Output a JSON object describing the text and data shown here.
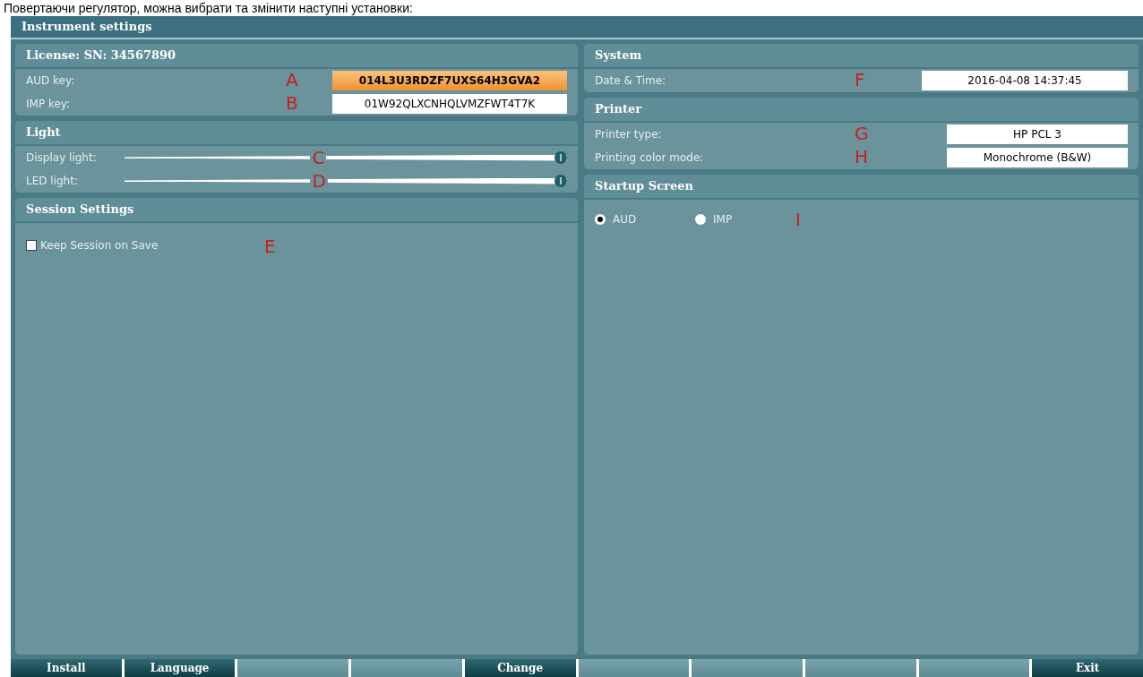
{
  "caption": "Повертаючи регулятор, можна вибрати та змінити наступні установки:",
  "window": {
    "title": "Instrument settings"
  },
  "license": {
    "title": "License: SN: 34567890",
    "rows": [
      {
        "label": "AUD key:",
        "marker": "A",
        "value": "014L3U3RDZF7UXS64H3GVA2",
        "selected": true
      },
      {
        "label": "IMP key:",
        "marker": "B",
        "value": "01W92QLXCNHQLVMZFWT4T7K",
        "selected": false
      }
    ]
  },
  "light": {
    "title": "Light",
    "sliders": [
      {
        "label": "Display light:",
        "marker": "C",
        "level": 1.0
      },
      {
        "label": "LED light:",
        "marker": "D",
        "level": 1.0
      }
    ]
  },
  "session": {
    "title": "Session Settings",
    "checkbox": {
      "label": "Keep Session on Save",
      "marker": "E",
      "checked": false
    }
  },
  "system": {
    "title": "System",
    "rows": [
      {
        "label": "Date & Time:",
        "marker": "F",
        "value": "2016-04-08 14:37:45"
      }
    ]
  },
  "printer": {
    "title": "Printer",
    "rows": [
      {
        "label": "Printer type:",
        "marker": "G",
        "value": "HP PCL 3"
      },
      {
        "label": "Printing color mode:",
        "marker": "H",
        "value": "Monochrome (B&W)"
      }
    ]
  },
  "startup": {
    "title": "Startup Screen",
    "marker": "I",
    "options": [
      {
        "label": "AUD",
        "selected": true
      },
      {
        "label": "IMP",
        "selected": false
      }
    ]
  },
  "buttons": [
    {
      "kind": "action",
      "label": "Install"
    },
    {
      "kind": "action",
      "label": "Language"
    },
    {
      "kind": "blank"
    },
    {
      "kind": "blank"
    },
    {
      "kind": "action",
      "label": "Change"
    },
    {
      "kind": "blank"
    },
    {
      "kind": "blank"
    },
    {
      "kind": "blank"
    },
    {
      "kind": "blank"
    },
    {
      "kind": "action",
      "label": "Exit"
    }
  ]
}
